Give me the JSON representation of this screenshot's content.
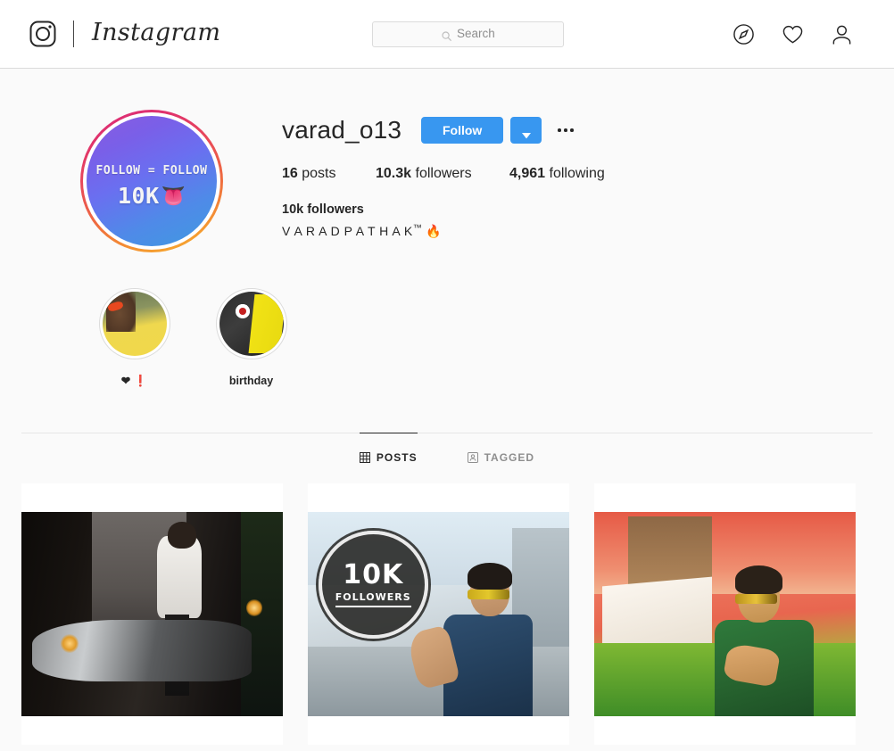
{
  "header": {
    "logo_icon": "instagram-camera-icon",
    "wordmark": "Instagram",
    "search": {
      "placeholder": "Search",
      "value": "",
      "icon": "search-icon"
    },
    "nav": [
      {
        "name": "explore",
        "icon": "compass-icon"
      },
      {
        "name": "activity",
        "icon": "heart-icon"
      },
      {
        "name": "profile",
        "icon": "person-icon"
      }
    ]
  },
  "profile": {
    "avatar": {
      "line1": "FOLLOW = FOLLOW",
      "line2": "10K",
      "emoji": "👅",
      "has_story_ring": true,
      "ring_colors": [
        "#d92c7f",
        "#ef6c3f",
        "#f7b733"
      ],
      "gradient_colors": [
        "#8a5ce0",
        "#3f9ae0"
      ]
    },
    "username": "varad_o13",
    "follow_label": "Follow",
    "follow_color": "#3897f0",
    "caret_icon": "chevron-down-icon",
    "options_icon": "ellipsis-icon",
    "stats": [
      {
        "value": "16",
        "label": "posts"
      },
      {
        "value": "10.3k",
        "label": "followers"
      },
      {
        "value": "4,961",
        "label": "following"
      }
    ],
    "bio_name": "10k followers",
    "bio_text": "V A R A D P A T H A K",
    "bio_tm": "™",
    "bio_emoji": "🔥"
  },
  "highlights": [
    {
      "label": "❤ ❗",
      "name": "highlight-heart"
    },
    {
      "label": "birthday",
      "name": "highlight-birthday"
    }
  ],
  "tabs": [
    {
      "label": "POSTS",
      "icon": "grid-icon",
      "active": true
    },
    {
      "label": "TAGGED",
      "icon": "tagged-person-icon",
      "active": false
    }
  ],
  "posts": [
    {
      "name": "post-motorcycle-night",
      "overlay": null
    },
    {
      "name": "post-10k-followers",
      "overlay": {
        "number": "10K",
        "caption": "FOLLOWERS"
      }
    },
    {
      "name": "post-green-kurta-red-filter",
      "overlay": null
    }
  ]
}
